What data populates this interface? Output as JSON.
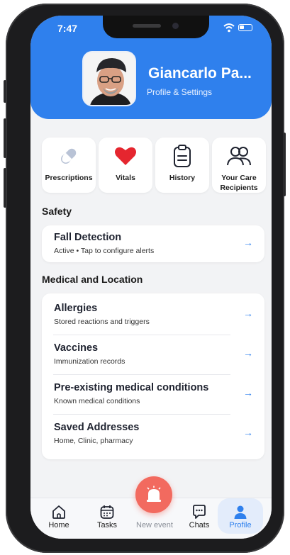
{
  "status_bar": {
    "time": "7:47"
  },
  "profile": {
    "name": "Giancarlo  Pa...",
    "subtitle": "Profile & Settings"
  },
  "quick_actions": [
    {
      "label": "Prescriptions",
      "icon": "pill-icon"
    },
    {
      "label": "Vitals",
      "icon": "heart-icon"
    },
    {
      "label": "History",
      "icon": "clipboard-icon"
    },
    {
      "label": "Your Care Recipients",
      "icon": "people-icon"
    }
  ],
  "safety": {
    "title": "Safety",
    "items": [
      {
        "title": "Fall Detection",
        "subtitle": "Active • Tap to configure alerts"
      }
    ]
  },
  "medical": {
    "title": "Medical and Location",
    "items": [
      {
        "title": "Allergies",
        "subtitle": "Stored reactions and triggers"
      },
      {
        "title": "Vaccines",
        "subtitle": "Immunization records"
      },
      {
        "title": "Pre-existing medical conditions",
        "subtitle": "Known medical conditions"
      },
      {
        "title": "Saved Addresses",
        "subtitle": "Home, Clinic, pharmacy"
      }
    ]
  },
  "tabs": [
    {
      "label": "Home",
      "icon": "home-icon"
    },
    {
      "label": "Tasks",
      "icon": "calendar-icon"
    },
    {
      "label": "New event",
      "icon": "alarm-icon"
    },
    {
      "label": "Chats",
      "icon": "chat-icon"
    },
    {
      "label": "Profile",
      "icon": "person-icon"
    }
  ],
  "colors": {
    "accent": "#2f80ed",
    "fab": "#f26a5f",
    "heart": "#e5262f"
  }
}
